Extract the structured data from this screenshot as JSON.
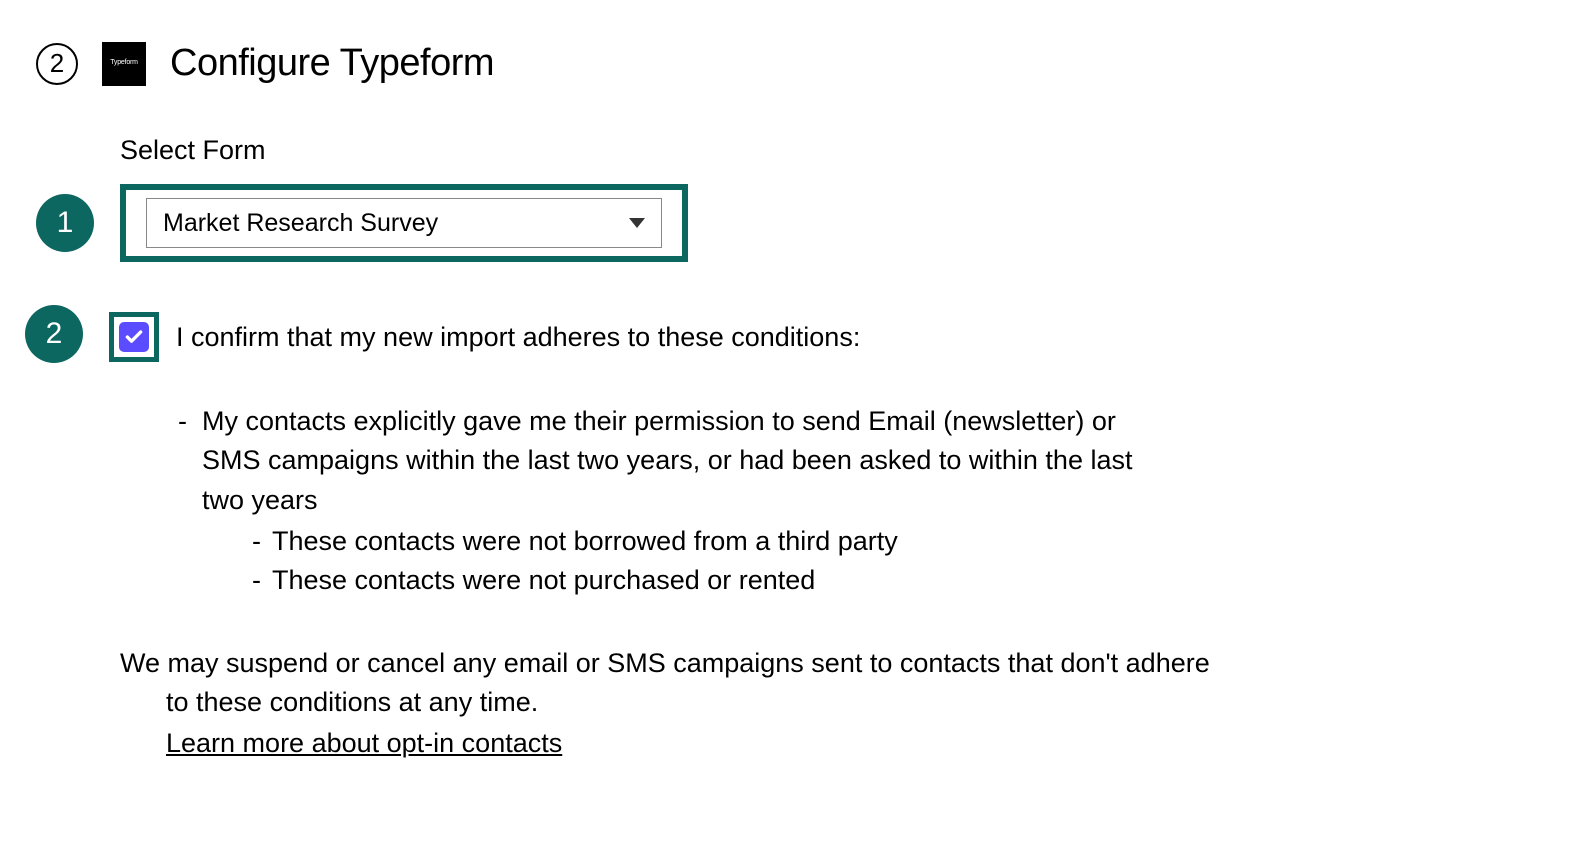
{
  "header": {
    "step_number": "2",
    "logo_text": "Typeform",
    "title": "Configure Typeform"
  },
  "callouts": {
    "one": "1",
    "two": "2"
  },
  "form": {
    "select_label": "Select Form",
    "select_value": "Market Research Survey"
  },
  "confirm": {
    "text": "I confirm that my new import adheres to these conditions:"
  },
  "conditions": {
    "main_line1": "My contacts explicitly gave me their permission to send Email (newsletter) or",
    "main_line2": "SMS campaigns within the last two years, or had been asked to within the last",
    "main_line3": "two years",
    "sub1": "These contacts were not borrowed from a third party",
    "sub2": "These contacts were not purchased or rented"
  },
  "footer": {
    "line1": "We may suspend or cancel any email or SMS campaigns sent to contacts that don't adhere",
    "line2": "to these conditions at any time.",
    "link": "Learn more about opt-in contacts"
  },
  "glyphs": {
    "dash": "-"
  }
}
